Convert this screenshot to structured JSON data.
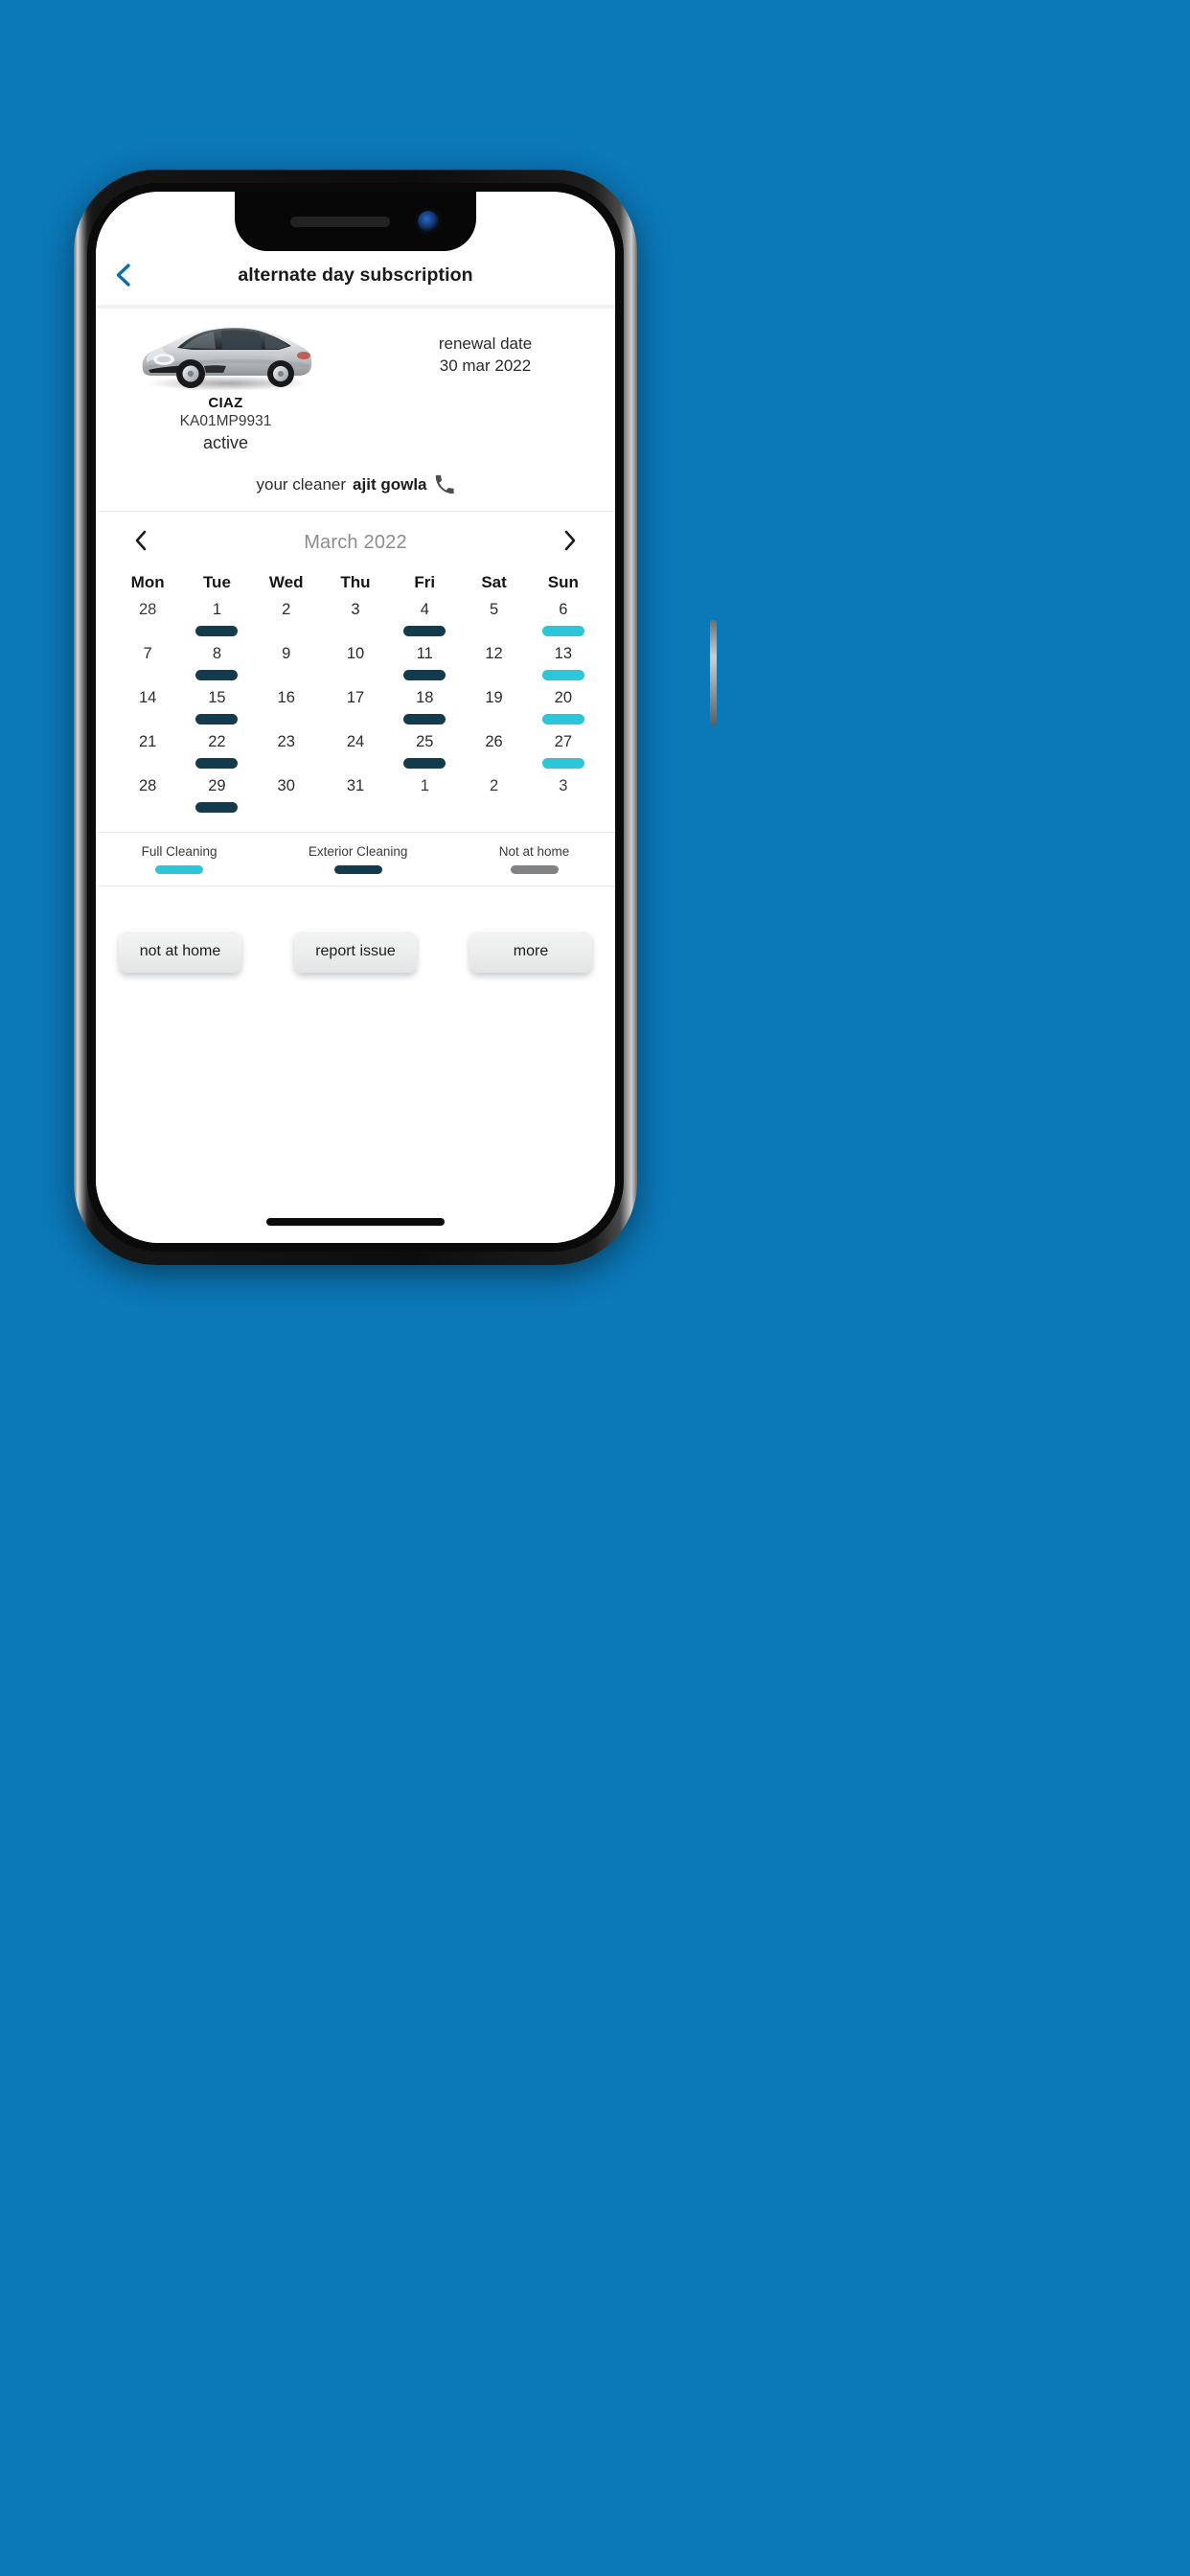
{
  "background_color": "#0b78b8",
  "appbar": {
    "back_icon": "chevron-left-icon",
    "back_color": "#0b6ea8",
    "title": "alternate day subscription"
  },
  "vehicle": {
    "image_alt": "silver-sedan-car",
    "name": "CIAZ",
    "plate": "KA01MP9931",
    "status": "active",
    "renewal_label": "renewal date",
    "renewal_date": "30 mar 2022",
    "cleaner_label": "your cleaner",
    "cleaner_name": "ajit gowla",
    "call_icon": "phone-icon"
  },
  "calendar": {
    "prev_icon": "chevron-left-icon",
    "next_icon": "chevron-right-icon",
    "month_title": "March 2022",
    "weekdays": [
      "Mon",
      "Tue",
      "Wed",
      "Thu",
      "Fri",
      "Sat",
      "Sun"
    ],
    "colors": {
      "full_cleaning": "#2cc6d8",
      "exterior_cleaning": "#123c4d",
      "not_at_home": "#808285",
      "none": "transparent"
    },
    "weeks": [
      [
        {
          "day": "28",
          "outside": true,
          "mark": "none"
        },
        {
          "day": "1",
          "outside": false,
          "mark": "exterior_cleaning"
        },
        {
          "day": "2",
          "outside": false,
          "mark": "none"
        },
        {
          "day": "3",
          "outside": false,
          "mark": "none"
        },
        {
          "day": "4",
          "outside": false,
          "mark": "exterior_cleaning"
        },
        {
          "day": "5",
          "outside": false,
          "mark": "none"
        },
        {
          "day": "6",
          "outside": false,
          "mark": "full_cleaning"
        }
      ],
      [
        {
          "day": "7",
          "outside": false,
          "mark": "none"
        },
        {
          "day": "8",
          "outside": false,
          "mark": "exterior_cleaning"
        },
        {
          "day": "9",
          "outside": false,
          "mark": "none"
        },
        {
          "day": "10",
          "outside": false,
          "mark": "none"
        },
        {
          "day": "11",
          "outside": false,
          "mark": "exterior_cleaning"
        },
        {
          "day": "12",
          "outside": false,
          "mark": "none"
        },
        {
          "day": "13",
          "outside": false,
          "mark": "full_cleaning"
        }
      ],
      [
        {
          "day": "14",
          "outside": false,
          "mark": "none"
        },
        {
          "day": "15",
          "outside": false,
          "mark": "exterior_cleaning"
        },
        {
          "day": "16",
          "outside": false,
          "mark": "none"
        },
        {
          "day": "17",
          "outside": false,
          "mark": "none"
        },
        {
          "day": "18",
          "outside": false,
          "mark": "exterior_cleaning"
        },
        {
          "day": "19",
          "outside": false,
          "mark": "none"
        },
        {
          "day": "20",
          "outside": false,
          "mark": "full_cleaning"
        }
      ],
      [
        {
          "day": "21",
          "outside": false,
          "mark": "none"
        },
        {
          "day": "22",
          "outside": false,
          "mark": "exterior_cleaning"
        },
        {
          "day": "23",
          "outside": false,
          "mark": "none"
        },
        {
          "day": "24",
          "outside": false,
          "mark": "none"
        },
        {
          "day": "25",
          "outside": false,
          "mark": "exterior_cleaning"
        },
        {
          "day": "26",
          "outside": false,
          "mark": "none"
        },
        {
          "day": "27",
          "outside": false,
          "mark": "full_cleaning"
        }
      ],
      [
        {
          "day": "28",
          "outside": false,
          "mark": "none"
        },
        {
          "day": "29",
          "outside": false,
          "mark": "exterior_cleaning"
        },
        {
          "day": "30",
          "outside": false,
          "mark": "none"
        },
        {
          "day": "31",
          "outside": false,
          "mark": "none"
        },
        {
          "day": "1",
          "outside": true,
          "mark": "none"
        },
        {
          "day": "2",
          "outside": true,
          "mark": "none"
        },
        {
          "day": "3",
          "outside": true,
          "mark": "none"
        }
      ]
    ]
  },
  "legend": [
    {
      "label": "Full Cleaning",
      "color": "#2cc6d8"
    },
    {
      "label": "Exterior Cleaning",
      "color": "#123c4d"
    },
    {
      "label": "Not at home",
      "color": "#808285"
    }
  ],
  "actions": [
    {
      "label": "not at home"
    },
    {
      "label": "report issue"
    },
    {
      "label": "more"
    }
  ]
}
